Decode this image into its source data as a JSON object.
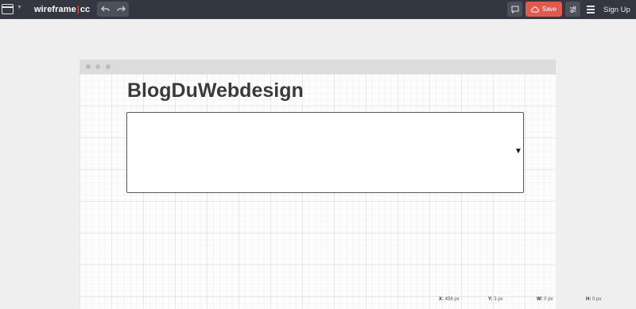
{
  "app": {
    "logo_left": "wireframe",
    "logo_sep": "|",
    "logo_right": "cc",
    "save_label": "Save",
    "signup_label": "Sign Up",
    "accent_color": "#e05a4f",
    "topbar_color": "#333740",
    "icons": {
      "window": "window-icon",
      "undo": "undo-icon",
      "redo": "redo-icon",
      "comment": "comment-icon",
      "cloud": "cloud-upload-icon",
      "settings": "sliders-icon",
      "menu": "hamburger-icon"
    }
  },
  "canvas": {
    "title": "BlogDuWebdesign",
    "dropdown_arrow": "▼"
  },
  "status": {
    "x_label": "X:",
    "x_value": "498 px",
    "y_label": "Y:",
    "y_value": "3 px",
    "w_label": "W:",
    "w_value": "0 px",
    "h_label": "H:",
    "h_value": "0 px"
  }
}
